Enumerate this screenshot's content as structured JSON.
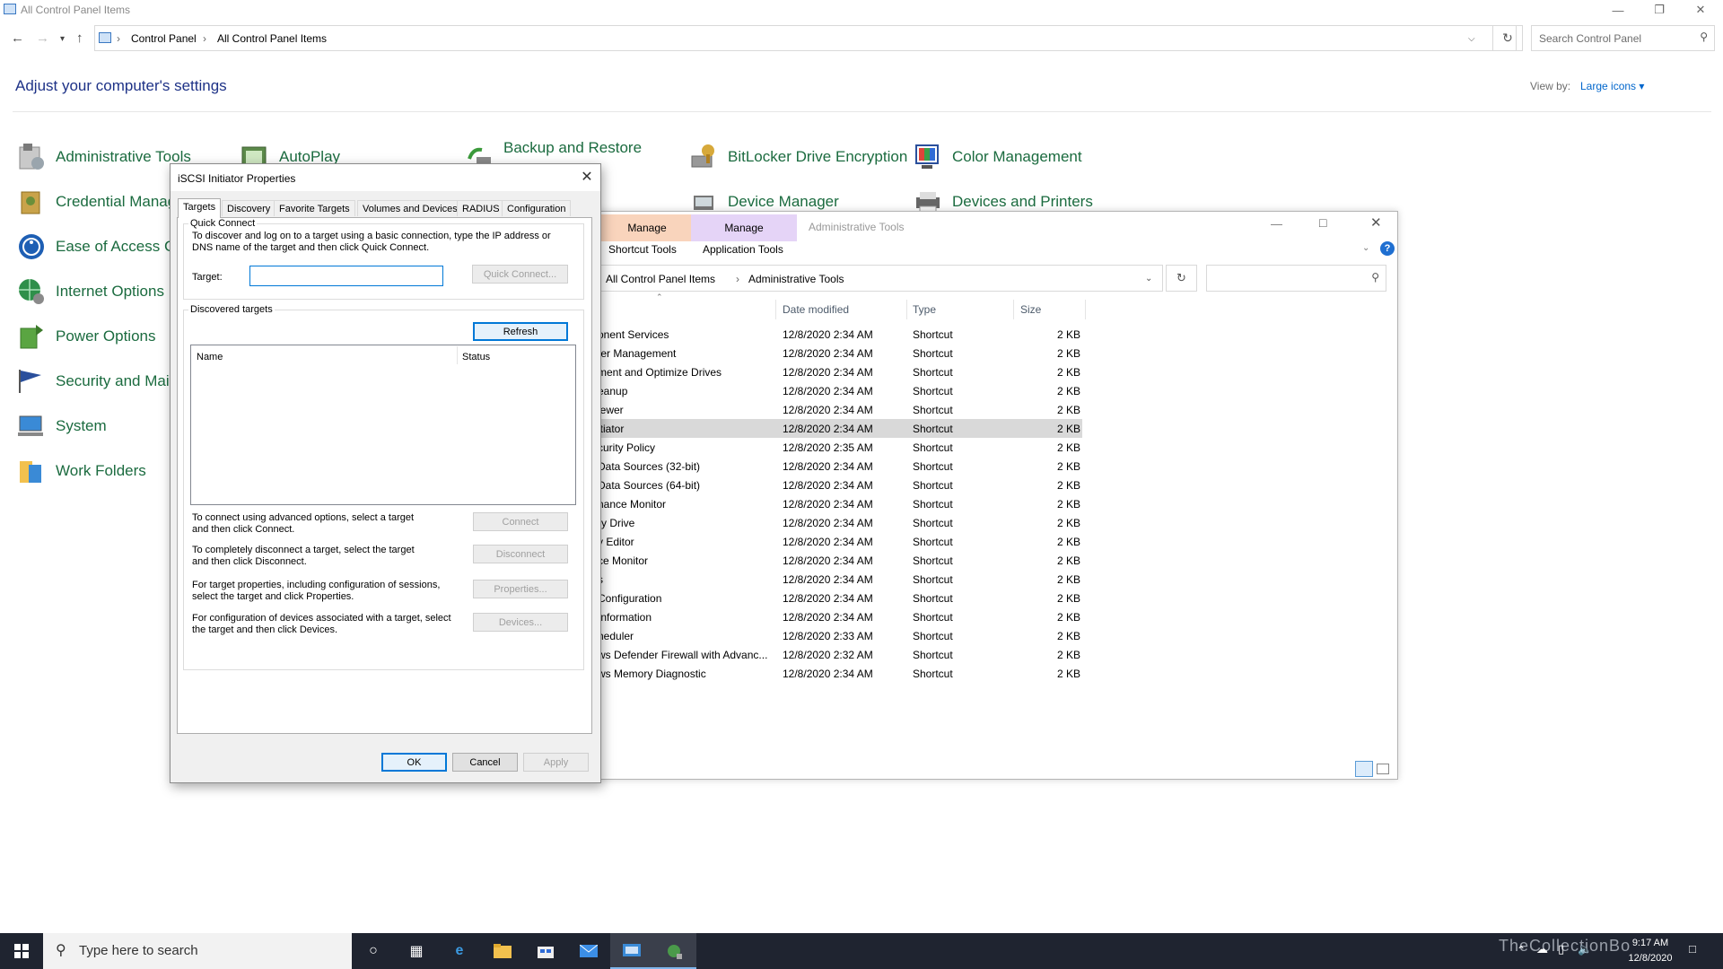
{
  "control_panel": {
    "title": "All Control Panel Items",
    "breadcrumbs": [
      "Control Panel",
      "All Control Panel Items"
    ],
    "search_placeholder": "Search Control Panel",
    "heading": "Adjust your computer's settings",
    "view_by_label": "View by:",
    "view_by_value": "Large icons",
    "items": [
      {
        "label": "Administrative Tools",
        "icon": "admin-tools-icon"
      },
      {
        "label": "AutoPlay",
        "icon": "autoplay-icon"
      },
      {
        "label": "Backup and Restore",
        "icon": "backup-restore-icon"
      },
      {
        "label": "BitLocker Drive Encryption",
        "icon": "bitlocker-icon"
      },
      {
        "label": "Color Management",
        "icon": "color-management-icon"
      },
      {
        "label": "Credential Manage",
        "icon": "credential-manager-icon"
      },
      {
        "label": "Device Manager",
        "icon": "device-manager-icon"
      },
      {
        "label": "Devices and Printers",
        "icon": "devices-printers-icon"
      },
      {
        "label": "Ease of Access Cen",
        "icon": "ease-of-access-icon"
      },
      {
        "label": "Internet Options",
        "icon": "internet-options-icon"
      },
      {
        "label": "Power Options",
        "icon": "power-options-icon"
      },
      {
        "label": "Security and Maint",
        "icon": "security-maintenance-icon"
      },
      {
        "label": "System",
        "icon": "system-icon"
      },
      {
        "label": "Work Folders",
        "icon": "work-folders-icon"
      }
    ]
  },
  "admin_tools": {
    "title": "Administrative Tools",
    "ribbon_tabs": [
      "Manage",
      "Manage"
    ],
    "ribbon_subtabs": [
      "Shortcut Tools",
      "Application Tools"
    ],
    "breadcrumbs": [
      "All Control Panel Items",
      "Administrative Tools"
    ],
    "columns": [
      "Date modified",
      "Type",
      "Size"
    ],
    "rows": [
      {
        "name": "onent Services",
        "date": "12/8/2020 2:34 AM",
        "type": "Shortcut",
        "size": "2 KB"
      },
      {
        "name": "ter Management",
        "date": "12/8/2020 2:34 AM",
        "type": "Shortcut",
        "size": "2 KB"
      },
      {
        "name": "ment and Optimize Drives",
        "date": "12/8/2020 2:34 AM",
        "type": "Shortcut",
        "size": "2 KB"
      },
      {
        "name": "eanup",
        "date": "12/8/2020 2:34 AM",
        "type": "Shortcut",
        "size": "2 KB"
      },
      {
        "name": "iewer",
        "date": "12/8/2020 2:34 AM",
        "type": "Shortcut",
        "size": "2 KB"
      },
      {
        "name": "itiator",
        "date": "12/8/2020 2:34 AM",
        "type": "Shortcut",
        "size": "2 KB"
      },
      {
        "name": "curity Policy",
        "date": "12/8/2020 2:35 AM",
        "type": "Shortcut",
        "size": "2 KB"
      },
      {
        "name": "Data Sources (32-bit)",
        "date": "12/8/2020 2:34 AM",
        "type": "Shortcut",
        "size": "2 KB"
      },
      {
        "name": "Data Sources (64-bit)",
        "date": "12/8/2020 2:34 AM",
        "type": "Shortcut",
        "size": "2 KB"
      },
      {
        "name": "nance Monitor",
        "date": "12/8/2020 2:34 AM",
        "type": "Shortcut",
        "size": "2 KB"
      },
      {
        "name": "ry Drive",
        "date": "12/8/2020 2:34 AM",
        "type": "Shortcut",
        "size": "2 KB"
      },
      {
        "name": "y Editor",
        "date": "12/8/2020 2:34 AM",
        "type": "Shortcut",
        "size": "2 KB"
      },
      {
        "name": "ce Monitor",
        "date": "12/8/2020 2:34 AM",
        "type": "Shortcut",
        "size": "2 KB"
      },
      {
        "name": "s",
        "date": "12/8/2020 2:34 AM",
        "type": "Shortcut",
        "size": "2 KB"
      },
      {
        "name": "Configuration",
        "date": "12/8/2020 2:34 AM",
        "type": "Shortcut",
        "size": "2 KB"
      },
      {
        "name": "Information",
        "date": "12/8/2020 2:34 AM",
        "type": "Shortcut",
        "size": "2 KB"
      },
      {
        "name": "heduler",
        "date": "12/8/2020 2:33 AM",
        "type": "Shortcut",
        "size": "2 KB"
      },
      {
        "name": "ws Defender Firewall with Advanc...",
        "date": "12/8/2020 2:32 AM",
        "type": "Shortcut",
        "size": "2 KB"
      },
      {
        "name": "ws Memory Diagnostic",
        "date": "12/8/2020 2:34 AM",
        "type": "Shortcut",
        "size": "2 KB"
      }
    ],
    "selected_row_index": 5
  },
  "iscsi": {
    "title": "iSCSI Initiator Properties",
    "tabs": [
      "Targets",
      "Discovery",
      "Favorite Targets",
      "Volumes and Devices",
      "RADIUS",
      "Configuration"
    ],
    "active_tab": "Targets",
    "quick_connect_group": "Quick Connect",
    "quick_connect_text": "To discover and log on to a target using a basic connection, type the IP address or DNS name of the target and then click Quick Connect.",
    "target_label": "Target:",
    "target_value": "",
    "quick_connect_button": "Quick Connect...",
    "discovered_group": "Discovered targets",
    "refresh_button": "Refresh",
    "list_columns": [
      "Name",
      "Status"
    ],
    "connect_text": "To connect using advanced options, select a target and then click Connect.",
    "connect_button": "Connect",
    "disconnect_text": "To completely disconnect a target, select the target and then click Disconnect.",
    "disconnect_button": "Disconnect",
    "properties_text": "For target properties, including configuration of sessions, select the target and click Properties.",
    "properties_button": "Properties...",
    "devices_text": "For configuration of devices associated with a target, select the target and then click Devices.",
    "devices_button": "Devices...",
    "ok_button": "OK",
    "cancel_button": "Cancel",
    "apply_button": "Apply"
  },
  "taskbar": {
    "search_placeholder": "Type here to search",
    "time": "9:17 AM",
    "date": "12/8/2020",
    "watermark": "TheCollectionBo"
  },
  "colors": {
    "link_green": "#1b6b3f",
    "heading_blue": "#1e3287",
    "accent": "#0078d7",
    "taskbar": "#1f2430"
  }
}
